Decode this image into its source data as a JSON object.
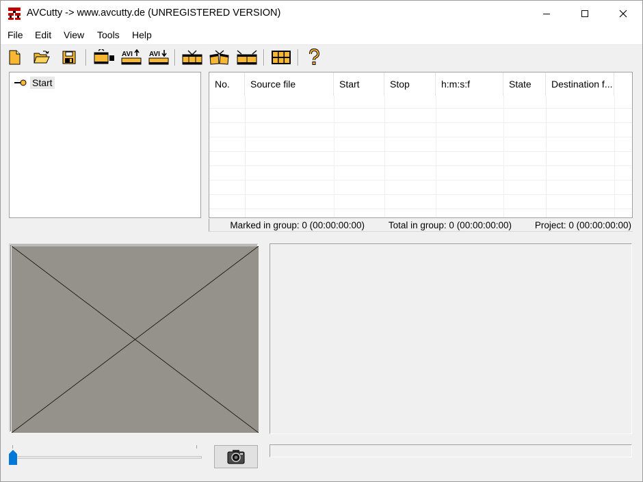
{
  "window": {
    "title": "AVCutty -> www.avcutty.de (UNREGISTERED VERSION)"
  },
  "menu": {
    "items": [
      "File",
      "Edit",
      "View",
      "Tools",
      "Help"
    ]
  },
  "toolbar": {
    "buttons": [
      "new-file-icon",
      "open-folder-icon",
      "save-disk-icon",
      "import-video-icon",
      "avi-export-icon",
      "avi-import-icon",
      "tv-cut-icon",
      "film-cut-icon",
      "film-split-icon",
      "grid-view-icon",
      "help-icon"
    ]
  },
  "tree": {
    "root_label": "Start"
  },
  "table": {
    "columns": [
      "No.",
      "Source file",
      "Start",
      "Stop",
      "h:m:s:f",
      "State",
      "Destination f..."
    ]
  },
  "status": {
    "marked": "Marked in group: 0 (00:00:00:00)",
    "total": "Total in group: 0 (00:00:00:00)",
    "project": "Project: 0 (00:00:00:00)"
  },
  "slider": {
    "position_fraction": 0
  },
  "colors": {
    "accent": "#0078d7",
    "preview_bg": "#95918b",
    "icon_orange": "#f7b733"
  }
}
